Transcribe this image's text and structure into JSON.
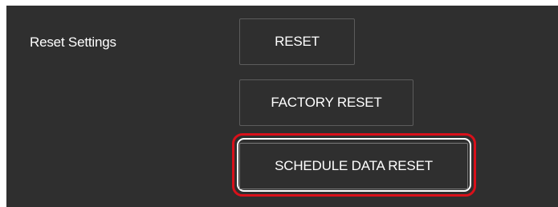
{
  "reset_settings": {
    "label": "Reset Settings",
    "buttons": {
      "reset": "RESET",
      "factory_reset": "FACTORY RESET",
      "schedule_data_reset": "SCHEDULE DATA RESET"
    }
  },
  "colors": {
    "panel_background": "#2f2f2f",
    "button_border": "#5c5c5c",
    "highlight_outline": "#d9101a"
  }
}
